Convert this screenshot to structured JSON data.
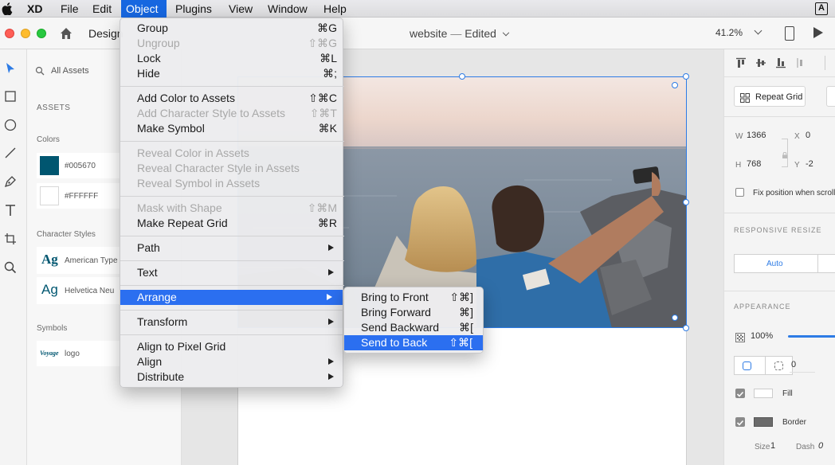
{
  "menubar": {
    "items": [
      "XD",
      "File",
      "Edit",
      "Object",
      "Plugins",
      "View",
      "Window",
      "Help"
    ],
    "active": "Object"
  },
  "titlebar": {
    "tab": "Design",
    "doc_name": "website",
    "doc_status": "Edited",
    "zoom": "41.2%"
  },
  "assets": {
    "search_placeholder": "All Assets",
    "heading": "ASSETS",
    "colors_label": "Colors",
    "colors": [
      {
        "hex": "#005670",
        "label": "#005670"
      },
      {
        "hex": "#FFFFFF",
        "label": "#FFFFFF"
      }
    ],
    "char_styles_label": "Character Styles",
    "char_styles": [
      {
        "glyph": "Ag",
        "label": "American Type"
      },
      {
        "glyph": "Ag",
        "label": "Helvetica Neu"
      }
    ],
    "symbols_label": "Symbols",
    "symbols": [
      {
        "thumb": "Voyage",
        "label": "logo"
      }
    ]
  },
  "object_menu": {
    "items": [
      {
        "label": "Group",
        "shortcut": "⌘G",
        "disabled": false
      },
      {
        "label": "Ungroup",
        "shortcut": "⇧⌘G",
        "disabled": true
      },
      {
        "label": "Lock",
        "shortcut": "⌘L",
        "disabled": false
      },
      {
        "label": "Hide",
        "shortcut": "⌘;",
        "disabled": false
      },
      {
        "label": "Add Color to Assets",
        "shortcut": "⇧⌘C",
        "disabled": false
      },
      {
        "label": "Add Character Style to Assets",
        "shortcut": "⇧⌘T",
        "disabled": true
      },
      {
        "label": "Make Symbol",
        "shortcut": "⌘K",
        "disabled": false
      },
      {
        "label": "Reveal Color in Assets",
        "shortcut": "",
        "disabled": true
      },
      {
        "label": "Reveal Character Style in Assets",
        "shortcut": "",
        "disabled": true
      },
      {
        "label": "Reveal Symbol in Assets",
        "shortcut": "",
        "disabled": true
      },
      {
        "label": "Mask with Shape",
        "shortcut": "⇧⌘M",
        "disabled": true
      },
      {
        "label": "Make Repeat Grid",
        "shortcut": "⌘R",
        "disabled": false
      },
      {
        "label": "Path",
        "submenu": true
      },
      {
        "label": "Text",
        "submenu": true
      },
      {
        "label": "Arrange",
        "submenu": true,
        "selected": true
      },
      {
        "label": "Transform",
        "submenu": true
      },
      {
        "label": "Align to Pixel Grid",
        "shortcut": ""
      },
      {
        "label": "Align",
        "submenu": true
      },
      {
        "label": "Distribute",
        "submenu": true
      }
    ]
  },
  "arrange_menu": {
    "items": [
      {
        "label": "Bring to Front",
        "shortcut": "⇧⌘]"
      },
      {
        "label": "Bring Forward",
        "shortcut": "⌘]"
      },
      {
        "label": "Send Backward",
        "shortcut": "⌘["
      },
      {
        "label": "Send to Back",
        "shortcut": "⇧⌘[",
        "selected": true
      }
    ]
  },
  "props": {
    "repeat_grid": "Repeat Grid",
    "w_label": "W",
    "w": "1366",
    "x_label": "X",
    "x": "0",
    "h_label": "H",
    "h": "768",
    "y_label": "Y",
    "y": "-2",
    "fix_position": "Fix position when scrolling",
    "responsive_resize": "RESPONSIVE RESIZE",
    "auto": "Auto",
    "appearance": "APPEARANCE",
    "opacity": "100%",
    "radius": "0",
    "fill_label": "Fill",
    "border_label": "Border",
    "size_label": "Size",
    "size": "1",
    "dash_label": "Dash",
    "dash": "0",
    "fill_checked": true,
    "border_checked": true,
    "fix_position_checked": false
  },
  "colors": {
    "accent": "#2b6ff0",
    "swatch_primary": "#005670",
    "border_swatch": "#6b6b6b"
  }
}
